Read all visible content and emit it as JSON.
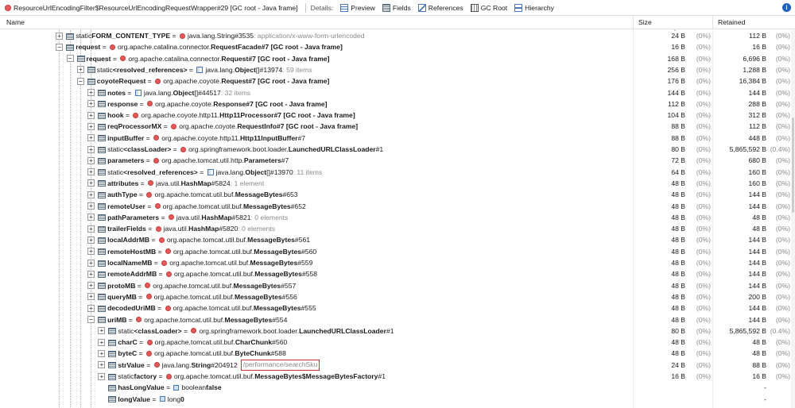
{
  "toolbar": {
    "title": "ResourceUrlEncodingFilter$ResourceUrlEncodingRequestWrapper#29 [GC root - Java frame]",
    "details_label": "Details:",
    "preview": "Preview",
    "fields": "Fields",
    "references": "References",
    "gc_root": "GC Root",
    "hierarchy": "Hierarchy"
  },
  "columns": {
    "name": "Name",
    "size": "Size",
    "retained": "Retained"
  },
  "rows": [
    {
      "level": 4,
      "exp": "+",
      "pre": "static ",
      "field": "FORM_CONTENT_TYPE",
      "icon": "class",
      "type": "java.lang.String#3535",
      "tb": false,
      "info": ": application/x-www-form-urlencoded",
      "size": "24 B",
      "spct": "(0%)",
      "ret": "112 B",
      "rpct": "(0%)"
    },
    {
      "level": 4,
      "exp": "-",
      "pre": "",
      "field": "request",
      "icon": "class",
      "type": "org.apache.catalina.connector.RequestFacade#7 [GC root - Java frame]",
      "tb": true,
      "tbpre": "org.apache.catalina.connector.",
      "tbname": "RequestFacade",
      "tbsuf": "#7 [GC root - Java frame]",
      "info": "",
      "size": "16 B",
      "spct": "(0%)",
      "ret": "16 B",
      "rpct": "(0%)"
    },
    {
      "level": 5,
      "exp": "-",
      "pre": "",
      "field": "request",
      "icon": "class",
      "tbpre": "org.apache.catalina.connector.",
      "tbname": "Request",
      "tbsuf": "#7 [GC root - Java frame]",
      "info": "",
      "size": "168 B",
      "spct": "(0%)",
      "ret": "6,696 B",
      "rpct": "(0%)"
    },
    {
      "level": 6,
      "exp": "+",
      "pre": "static ",
      "field": "<resolved_references>",
      "icon": "array",
      "tbpre": "java.lang.",
      "tbname": "Object",
      "tbsuf": "[]#13974",
      "info": " : 59 items",
      "size": "256 B",
      "spct": "(0%)",
      "ret": "1,288 B",
      "rpct": "(0%)"
    },
    {
      "level": 6,
      "exp": "-",
      "pre": "",
      "field": "coyoteRequest",
      "icon": "class",
      "tbpre": "org.apache.coyote.",
      "tbname": "Request",
      "tbsuf": "#7 [GC root - Java frame]",
      "info": "",
      "size": "176 B",
      "spct": "(0%)",
      "ret": "16,384 B",
      "rpct": "(0%)"
    },
    {
      "level": 7,
      "exp": "+",
      "pre": "",
      "field": "notes",
      "icon": "array",
      "tbpre": "java.lang.",
      "tbname": "Object",
      "tbsuf": "[]#44517",
      "info": " : 32 items",
      "size": "144 B",
      "spct": "(0%)",
      "ret": "144 B",
      "rpct": "(0%)"
    },
    {
      "level": 7,
      "exp": "+",
      "pre": "",
      "field": "response",
      "icon": "class",
      "tbpre": "org.apache.coyote.",
      "tbname": "Response",
      "tbsuf": "#7 [GC root - Java frame]",
      "info": "",
      "size": "112 B",
      "spct": "(0%)",
      "ret": "288 B",
      "rpct": "(0%)"
    },
    {
      "level": 7,
      "exp": "+",
      "pre": "",
      "field": "hook",
      "icon": "class",
      "tbpre": "org.apache.coyote.http11.",
      "tbname": "Http11Processor",
      "tbsuf": "#7 [GC root - Java frame]",
      "info": "",
      "size": "104 B",
      "spct": "(0%)",
      "ret": "312 B",
      "rpct": "(0%)"
    },
    {
      "level": 7,
      "exp": "+",
      "pre": "",
      "field": "reqProcessorMX",
      "icon": "class",
      "tbpre": "org.apache.coyote.",
      "tbname": "RequestInfo",
      "tbsuf": "#7 [GC root - Java frame]",
      "info": "",
      "size": "88 B",
      "spct": "(0%)",
      "ret": "112 B",
      "rpct": "(0%)"
    },
    {
      "level": 7,
      "exp": "+",
      "pre": "",
      "field": "inputBuffer",
      "icon": "class",
      "tbpre": "org.apache.coyote.http11.",
      "tbname": "Http11InputBuffer",
      "tbsuf": "#7",
      "info": "",
      "size": "88 B",
      "spct": "(0%)",
      "ret": "448 B",
      "rpct": "(0%)"
    },
    {
      "level": 7,
      "exp": "+",
      "pre": "static ",
      "field": "<classLoader>",
      "icon": "class",
      "tbpre": "org.springframework.boot.loader.",
      "tbname": "LaunchedURLClassLoader",
      "tbsuf": "#1",
      "info": "",
      "size": "80 B",
      "spct": "(0%)",
      "ret": "5,865,592 B",
      "rpct": "(0.4%)"
    },
    {
      "level": 7,
      "exp": "+",
      "pre": "",
      "field": "parameters",
      "icon": "class",
      "tbpre": "org.apache.tomcat.util.http.",
      "tbname": "Parameters",
      "tbsuf": "#7",
      "info": "",
      "size": "72 B",
      "spct": "(0%)",
      "ret": "680 B",
      "rpct": "(0%)"
    },
    {
      "level": 7,
      "exp": "+",
      "pre": "static ",
      "field": "<resolved_references>",
      "icon": "array",
      "tbpre": "java.lang.",
      "tbname": "Object",
      "tbsuf": "[]#13970",
      "info": " : 11 items",
      "size": "64 B",
      "spct": "(0%)",
      "ret": "160 B",
      "rpct": "(0%)"
    },
    {
      "level": 7,
      "exp": "+",
      "pre": "",
      "field": "attributes",
      "icon": "class",
      "tbpre": "java.util.",
      "tbname": "HashMap",
      "tbsuf": "#5824",
      "info": " : 1 element",
      "size": "48 B",
      "spct": "(0%)",
      "ret": "160 B",
      "rpct": "(0%)"
    },
    {
      "level": 7,
      "exp": "+",
      "pre": "",
      "field": "authType",
      "icon": "class",
      "tbpre": "org.apache.tomcat.util.buf.",
      "tbname": "MessageBytes",
      "tbsuf": "#653",
      "info": "",
      "size": "48 B",
      "spct": "(0%)",
      "ret": "144 B",
      "rpct": "(0%)"
    },
    {
      "level": 7,
      "exp": "+",
      "pre": "",
      "field": "remoteUser",
      "icon": "class",
      "tbpre": "org.apache.tomcat.util.buf.",
      "tbname": "MessageBytes",
      "tbsuf": "#652",
      "info": "",
      "size": "48 B",
      "spct": "(0%)",
      "ret": "144 B",
      "rpct": "(0%)"
    },
    {
      "level": 7,
      "exp": "+",
      "pre": "",
      "field": "pathParameters",
      "icon": "class",
      "tbpre": "java.util.",
      "tbname": "HashMap",
      "tbsuf": "#5821",
      "info": " : 0 elements",
      "size": "48 B",
      "spct": "(0%)",
      "ret": "48 B",
      "rpct": "(0%)"
    },
    {
      "level": 7,
      "exp": "+",
      "pre": "",
      "field": "trailerFields",
      "icon": "class",
      "tbpre": "java.util.",
      "tbname": "HashMap",
      "tbsuf": "#5820",
      "info": " : 0 elements",
      "size": "48 B",
      "spct": "(0%)",
      "ret": "48 B",
      "rpct": "(0%)"
    },
    {
      "level": 7,
      "exp": "+",
      "pre": "",
      "field": "localAddrMB",
      "icon": "class",
      "tbpre": "org.apache.tomcat.util.buf.",
      "tbname": "MessageBytes",
      "tbsuf": "#561",
      "info": "",
      "size": "48 B",
      "spct": "(0%)",
      "ret": "144 B",
      "rpct": "(0%)"
    },
    {
      "level": 7,
      "exp": "+",
      "pre": "",
      "field": "remoteHostMB",
      "icon": "class",
      "tbpre": "org.apache.tomcat.util.buf.",
      "tbname": "MessageBytes",
      "tbsuf": "#560",
      "info": "",
      "size": "48 B",
      "spct": "(0%)",
      "ret": "144 B",
      "rpct": "(0%)"
    },
    {
      "level": 7,
      "exp": "+",
      "pre": "",
      "field": "localNameMB",
      "icon": "class",
      "tbpre": "org.apache.tomcat.util.buf.",
      "tbname": "MessageBytes",
      "tbsuf": "#559",
      "info": "",
      "size": "48 B",
      "spct": "(0%)",
      "ret": "144 B",
      "rpct": "(0%)"
    },
    {
      "level": 7,
      "exp": "+",
      "pre": "",
      "field": "remoteAddrMB",
      "icon": "class",
      "tbpre": "org.apache.tomcat.util.buf.",
      "tbname": "MessageBytes",
      "tbsuf": "#558",
      "info": "",
      "size": "48 B",
      "spct": "(0%)",
      "ret": "144 B",
      "rpct": "(0%)"
    },
    {
      "level": 7,
      "exp": "+",
      "pre": "",
      "field": "protoMB",
      "icon": "class",
      "tbpre": "org.apache.tomcat.util.buf.",
      "tbname": "MessageBytes",
      "tbsuf": "#557",
      "info": "",
      "size": "48 B",
      "spct": "(0%)",
      "ret": "144 B",
      "rpct": "(0%)"
    },
    {
      "level": 7,
      "exp": "+",
      "pre": "",
      "field": "queryMB",
      "icon": "class",
      "tbpre": "org.apache.tomcat.util.buf.",
      "tbname": "MessageBytes",
      "tbsuf": "#556",
      "info": "",
      "size": "48 B",
      "spct": "(0%)",
      "ret": "200 B",
      "rpct": "(0%)"
    },
    {
      "level": 7,
      "exp": "+",
      "pre": "",
      "field": "decodedUriMB",
      "icon": "class",
      "tbpre": "org.apache.tomcat.util.buf.",
      "tbname": "MessageBytes",
      "tbsuf": "#555",
      "info": "",
      "size": "48 B",
      "spct": "(0%)",
      "ret": "144 B",
      "rpct": "(0%)"
    },
    {
      "level": 7,
      "exp": "-",
      "pre": "",
      "field": "uriMB",
      "icon": "class",
      "tbpre": "org.apache.tomcat.util.buf.",
      "tbname": "MessageBytes",
      "tbsuf": "#554",
      "info": "",
      "size": "48 B",
      "spct": "(0%)",
      "ret": "144 B",
      "rpct": "(0%)"
    },
    {
      "level": 8,
      "exp": "+",
      "pre": "static ",
      "field": "<classLoader>",
      "icon": "class",
      "tbpre": "org.springframework.boot.loader.",
      "tbname": "LaunchedURLClassLoader",
      "tbsuf": "#1",
      "info": "",
      "size": "80 B",
      "spct": "(0%)",
      "ret": "5,865,592 B",
      "rpct": "(0.4%)"
    },
    {
      "level": 8,
      "exp": "+",
      "pre": "",
      "field": "charC",
      "icon": "class",
      "tbpre": "org.apache.tomcat.util.buf.",
      "tbname": "CharChunk",
      "tbsuf": "#560",
      "info": "",
      "size": "48 B",
      "spct": "(0%)",
      "ret": "48 B",
      "rpct": "(0%)"
    },
    {
      "level": 8,
      "exp": "+",
      "pre": "",
      "field": "byteC",
      "icon": "class",
      "tbpre": "org.apache.tomcat.util.buf.",
      "tbname": "ByteChunk",
      "tbsuf": "#588",
      "info": "",
      "size": "48 B",
      "spct": "(0%)",
      "ret": "48 B",
      "rpct": "(0%)"
    },
    {
      "level": 8,
      "exp": "+",
      "pre": "",
      "field": "strValue",
      "icon": "class",
      "tbpre": "java.lang.",
      "tbname": "String",
      "tbsuf": "#204912",
      "info": "",
      "hl": "/performance/searchSku",
      "size": "24 B",
      "spct": "(0%)",
      "ret": "88 B",
      "rpct": "(0%)"
    },
    {
      "level": 8,
      "exp": "+",
      "pre": "static ",
      "field": "factory",
      "icon": "class",
      "tbpre": "org.apache.tomcat.util.buf.",
      "tbname": "MessageBytes$MessageBytesFactory",
      "tbsuf": "#1",
      "info": "",
      "size": "16 B",
      "spct": "(0%)",
      "ret": "16 B",
      "rpct": "(0%)"
    },
    {
      "level": 8,
      "exp": "",
      "pre": "",
      "field": "hasLongValue",
      "icon": "prim",
      "tbpre": "boolean ",
      "tbname": "false",
      "tbsuf": "",
      "info": "",
      "size": "",
      "spct": "",
      "ret": "-",
      "rpct": ""
    },
    {
      "level": 8,
      "exp": "",
      "pre": "",
      "field": "longValue",
      "icon": "prim",
      "tbpre": "long ",
      "tbname": "0",
      "tbsuf": "",
      "info": "",
      "size": "",
      "spct": "",
      "ret": "-",
      "rpct": ""
    }
  ]
}
